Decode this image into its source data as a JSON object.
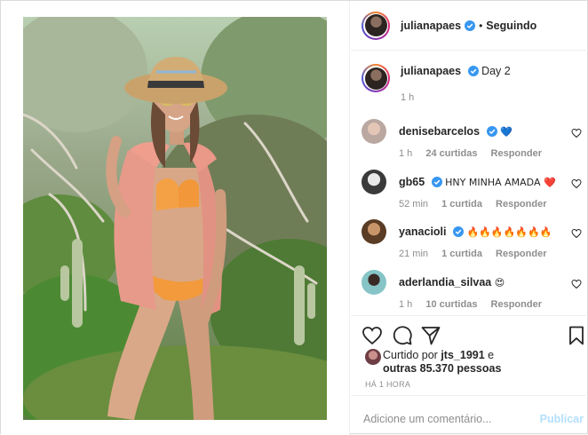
{
  "header": {
    "username": "julianapaes",
    "separator": "•",
    "follow_status": "Seguindo"
  },
  "caption": {
    "username": "julianapaes",
    "text": "Day 2",
    "time": "1 h"
  },
  "comments": [
    {
      "username": "denisebarcelos",
      "text": "💙",
      "time": "1 h",
      "likes": "24 curtidas",
      "reply": "Responder",
      "verified": true,
      "avatar_color": "#b9a7a0"
    },
    {
      "username": "gb65",
      "text": "HNY MINHA AMADA ❤️",
      "time": "52 min",
      "likes": "1 curtida",
      "reply": "Responder",
      "verified": true,
      "avatar_color": "#3a3a3a"
    },
    {
      "username": "yanacioli",
      "text": "🔥🔥🔥🔥🔥🔥🔥",
      "time": "21 min",
      "likes": "1 curtida",
      "reply": "Responder",
      "verified": true,
      "avatar_color": "#7a5a3e"
    },
    {
      "username": "aderlandia_silvaa",
      "text": "😍",
      "time": "1 h",
      "likes": "10 curtidas",
      "reply": "Responder",
      "verified": false,
      "avatar_color": "#4d8fa3"
    }
  ],
  "likes": {
    "prefix": "Curtido por",
    "user": "jts_1991",
    "conjunction": "e",
    "others": "outras 85.370 pessoas"
  },
  "timestamp": "HÁ 1 HORA",
  "composer": {
    "placeholder": "Adicione um comentário...",
    "publish": "Publicar"
  },
  "colors": {
    "verified": "#3897f0",
    "muted": "#8e8e8e",
    "publish_disabled": "#b2dffc"
  },
  "icons": [
    "more-icon",
    "heart-icon",
    "comment-icon",
    "share-icon",
    "bookmark-icon",
    "verified-icon"
  ]
}
